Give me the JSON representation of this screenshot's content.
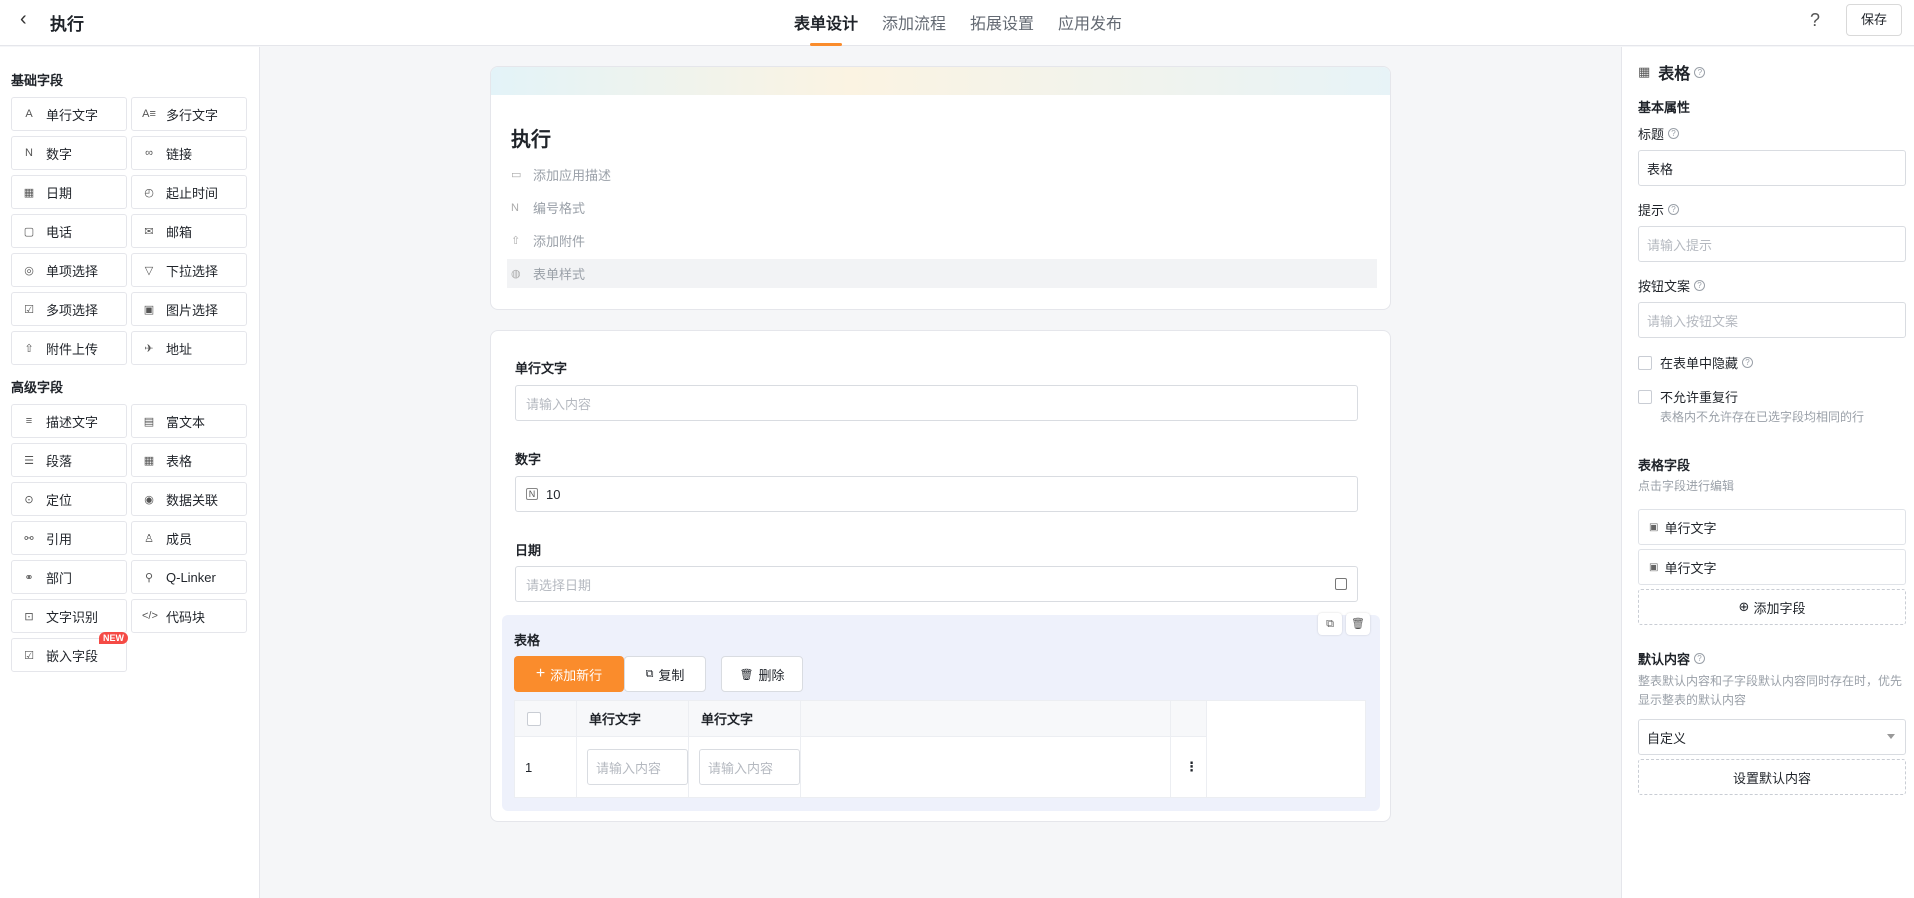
{
  "header": {
    "back_icon": "chevron-left-icon",
    "title": "执行",
    "tabs": [
      {
        "label": "表单设计",
        "active": true
      },
      {
        "label": "添加流程",
        "active": false
      },
      {
        "label": "拓展设置",
        "active": false
      },
      {
        "label": "应用发布",
        "active": false
      }
    ],
    "help": "?",
    "save": "保存"
  },
  "left": {
    "basic_title": "基础字段",
    "basic": [
      {
        "label": "单行文字",
        "icon": "A"
      },
      {
        "label": "多行文字",
        "icon": "A≡"
      },
      {
        "label": "数字",
        "icon": "N"
      },
      {
        "label": "链接",
        "icon": "∞"
      },
      {
        "label": "日期",
        "icon": "▦"
      },
      {
        "label": "起止时间",
        "icon": "◴"
      },
      {
        "label": "电话",
        "icon": "▢"
      },
      {
        "label": "邮箱",
        "icon": "✉"
      },
      {
        "label": "单项选择",
        "icon": "◎"
      },
      {
        "label": "下拉选择",
        "icon": "▽"
      },
      {
        "label": "多项选择",
        "icon": "☑"
      },
      {
        "label": "图片选择",
        "icon": "▣"
      },
      {
        "label": "附件上传",
        "icon": "⇧"
      },
      {
        "label": "地址",
        "icon": "✈"
      }
    ],
    "advanced_title": "高级字段",
    "advanced": [
      {
        "label": "描述文字",
        "icon": "≡"
      },
      {
        "label": "富文本",
        "icon": "▤"
      },
      {
        "label": "段落",
        "icon": "☰"
      },
      {
        "label": "表格",
        "icon": "▦"
      },
      {
        "label": "定位",
        "icon": "⊙"
      },
      {
        "label": "数据关联",
        "icon": "◉"
      },
      {
        "label": "引用",
        "icon": "⚯"
      },
      {
        "label": "成员",
        "icon": "♙"
      },
      {
        "label": "部门",
        "icon": "⚭"
      },
      {
        "label": "Q-Linker",
        "icon": "⚲"
      },
      {
        "label": "文字识别",
        "icon": "⊡"
      },
      {
        "label": "代码块",
        "icon": "</>"
      },
      {
        "label": "嵌入字段",
        "icon": "☑",
        "badge": "NEW"
      }
    ]
  },
  "form": {
    "title": "执行",
    "meta": [
      {
        "label": "添加应用描述",
        "icon": "▭"
      },
      {
        "label": "编号格式",
        "icon": "N"
      },
      {
        "label": "添加附件",
        "icon": "⇧"
      },
      {
        "label": "表单样式",
        "icon": "◍"
      }
    ],
    "fields": {
      "text_label": "单行文字",
      "text_placeholder": "请输入内容",
      "number_label": "数字",
      "number_icon": "N",
      "number_value": "10",
      "date_label": "日期",
      "date_placeholder": "请选择日期"
    },
    "table": {
      "title": "表格",
      "add_row": "添加新行",
      "copy": "复制",
      "delete": "删除",
      "col1": "单行文字",
      "col2": "单行文字",
      "row_index": "1",
      "cell_placeholder": "请输入内容",
      "more": "⋮"
    }
  },
  "right": {
    "title": "表格",
    "basic_props": "基本属性",
    "title_label": "标题",
    "title_value": "表格",
    "hint_label": "提示",
    "hint_placeholder": "请输入提示",
    "button_label": "按钮文案",
    "button_placeholder": "请输入按钮文案",
    "hide_label": "在表单中隐藏",
    "no_dup_label": "不允许重复行",
    "no_dup_hint": "表格内不允许存在已选字段均相同的行",
    "table_fields_title": "表格字段",
    "table_fields_hint": "点击字段进行编辑",
    "sub_fields": [
      "单行文字",
      "单行文字"
    ],
    "add_field": "添加字段",
    "default_title": "默认内容",
    "default_hint": "整表默认内容和子字段默认内容同时存在时，优先显示整表的默认内容",
    "default_select": "自定义",
    "set_default": "设置默认内容"
  }
}
